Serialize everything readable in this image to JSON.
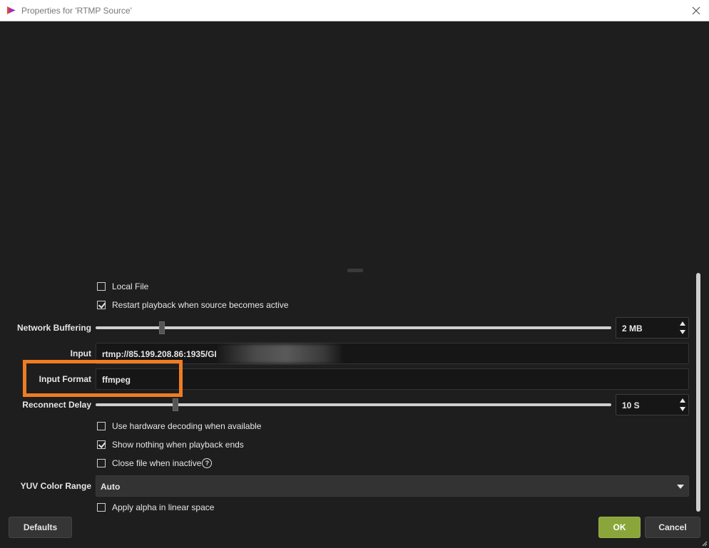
{
  "window": {
    "title": "Properties for 'RTMP Source'"
  },
  "checkboxes": {
    "local_file": {
      "label": "Local File",
      "checked": false
    },
    "restart_playback": {
      "label": "Restart playback when source becomes active",
      "checked": true
    },
    "hw_decoding": {
      "label": "Use hardware decoding when available",
      "checked": false
    },
    "show_nothing": {
      "label": "Show nothing when playback ends",
      "checked": true
    },
    "close_inactive": {
      "label": "Close file when inactive",
      "checked": false
    },
    "alpha_linear": {
      "label": "Apply alpha in linear space",
      "checked": false
    }
  },
  "network_buffering": {
    "label": "Network Buffering",
    "value": "2 MB",
    "level": 0.128
  },
  "input": {
    "label": "Input",
    "value": "rtmp://85.199.208.86:1935/GI"
  },
  "input_format": {
    "label": "Input Format",
    "value": "ffmpeg"
  },
  "reconnect_delay": {
    "label": "Reconnect Delay",
    "value": "10 S",
    "level": 0.155
  },
  "help_glyph": "?",
  "yuv_color_range": {
    "label": "YUV Color Range",
    "value": "Auto"
  },
  "buttons": {
    "defaults": "Defaults",
    "ok": "OK",
    "cancel": "Cancel"
  },
  "colors": {
    "ok_button": "#8aa63a",
    "highlight": "#f07c21",
    "background": "#1e1e1e"
  },
  "icons": {
    "app": "app-logo-icon",
    "close": "close-icon",
    "dropdown": "chevron-down-icon",
    "help": "help-icon"
  }
}
